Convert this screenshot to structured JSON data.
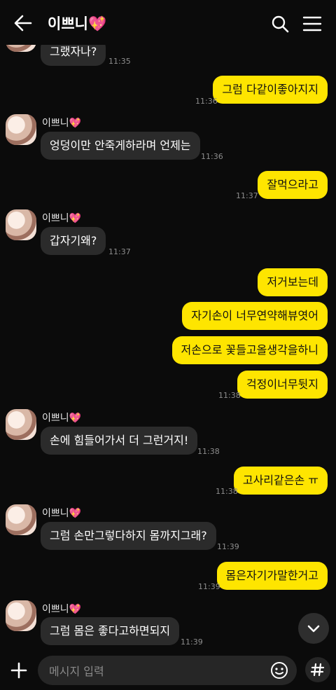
{
  "header": {
    "title": "이쁘니",
    "title_emoji": "💖",
    "back_icon": "arrow-left-icon",
    "search_icon": "search-icon",
    "menu_icon": "menu-icon"
  },
  "contact": {
    "name": "이쁘니💖"
  },
  "messages": [
    {
      "side": "in",
      "text": "그랬자나?",
      "time": "11:35"
    },
    {
      "side": "out",
      "text": "그럼 다같이좋아지지",
      "time": "11:36"
    },
    {
      "side": "in",
      "text": "엉덩이만 안죽게하라며 언제는",
      "time": "11:36"
    },
    {
      "side": "out",
      "text": "잘먹으라고",
      "time": "11:37"
    },
    {
      "side": "in",
      "text": "갑자기왜?",
      "time": "11:37"
    },
    {
      "side": "out",
      "text": "저거보는데",
      "time": ""
    },
    {
      "side": "out",
      "text": "자기손이 너무연약해뷰엿어",
      "time": ""
    },
    {
      "side": "out",
      "text": "저손으로 꽃들고올생각을하니",
      "time": ""
    },
    {
      "side": "out",
      "text": "걱정이너무뒷지",
      "time": "11:38"
    },
    {
      "side": "in",
      "text": "손에 힘들어가서 더 그런거지!",
      "time": "11:38"
    },
    {
      "side": "out",
      "text": "고사리같은손 ㅠ",
      "time": "11:38"
    },
    {
      "side": "in",
      "text": "그럼 손만그렇다하지 몸까지그래?",
      "time": "11:39"
    },
    {
      "side": "out",
      "text": "몸은자기가말한거고",
      "time": "11:39"
    },
    {
      "side": "in",
      "text": "그럼 몸은 좋다고하면되지",
      "time": "11:39"
    }
  ],
  "input": {
    "placeholder": "메시지 입력"
  },
  "icons": {
    "plus": "plus-icon",
    "emoji": "emoji-icon",
    "hash": "hash-icon",
    "scroll_down": "chevron-down-icon"
  },
  "colors": {
    "background": "#0b0b0b",
    "outgoing": "#fee500",
    "incoming": "#2b2b2b",
    "time": "#8d8d8d"
  }
}
